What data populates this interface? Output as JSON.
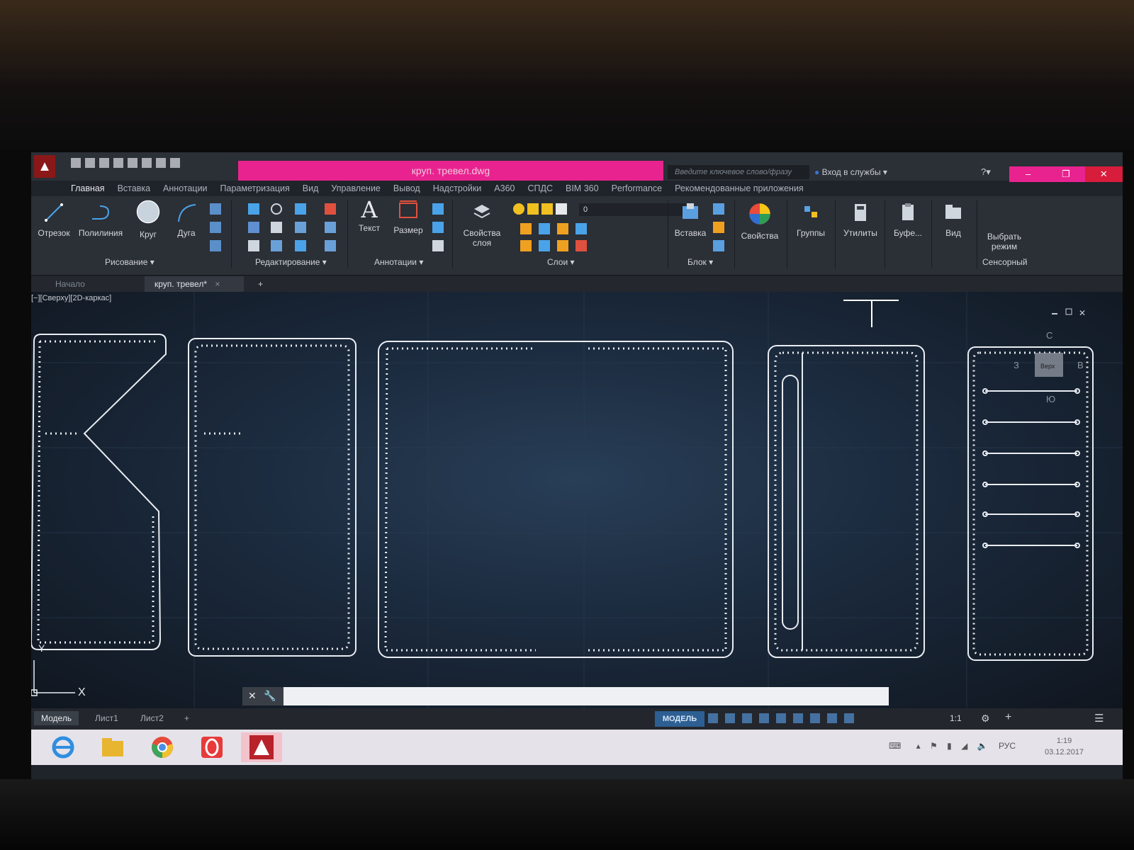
{
  "app": {
    "document_title": "круп. тревел.dwg",
    "search_placeholder": "Введите ключевое слово/фразу",
    "signin_label": "Вход в службы"
  },
  "ribbon_tabs": [
    "Главная",
    "Вставка",
    "Аннотации",
    "Параметризация",
    "Вид",
    "Управление",
    "Вывод",
    "Надстройки",
    "A360",
    "СПДС",
    "BIM 360",
    "Performance",
    "Рекомендованные приложения"
  ],
  "tools": {
    "line": "Отрезок",
    "polyline": "Полилиния",
    "circle": "Круг",
    "arc": "Дуга",
    "text": "Текст",
    "dimension": "Размер",
    "layer_props_1": "Свойства",
    "layer_props_2": "слоя",
    "insert": "Вставка",
    "properties": "Свойства",
    "groups": "Группы",
    "utilities": "Утилиты",
    "clipboard": "Буфе...",
    "view": "Вид",
    "select_mode_1": "Выбрать",
    "select_mode_2": "режим",
    "layer_value": "0"
  },
  "panels": {
    "draw": "Рисование ▾",
    "modify": "Редактирование ▾",
    "annotation": "Аннотации ▾",
    "layers": "Слои ▾",
    "block": "Блок ▾",
    "touch": "Сенсорный"
  },
  "file_tabs": {
    "start": "Начало",
    "current": "круп. тревел*"
  },
  "viewport": {
    "label": "[−][Сверху][2D-каркас]",
    "viewcube_top": "Верх",
    "viewcube_n": "С",
    "viewcube_s": "Ю",
    "viewcube_w": "З",
    "viewcube_e": "В",
    "ucs_x": "X",
    "ucs_y": "Y"
  },
  "layout_tabs": [
    "Модель",
    "Лист1",
    "Лист2"
  ],
  "status": {
    "model": "МОДЕЛЬ",
    "scale": "1:1"
  },
  "taskbar": {
    "lang": "РУС",
    "time": "1:19",
    "date": "03.12.2017"
  }
}
